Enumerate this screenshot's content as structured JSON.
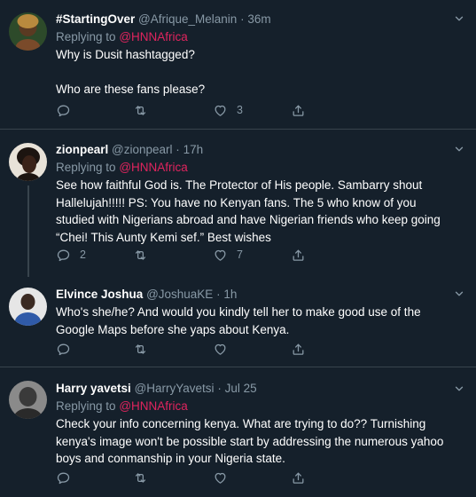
{
  "tweets": [
    {
      "name": "#StartingOver",
      "handle": "@Afrique_Melanin",
      "time": "36m",
      "reply_prefix": "Replying to",
      "reply_to": "@HNNAfrica",
      "text": "Why is Dusit hashtagged?\n\nWho are these fans please?",
      "like_count": "3",
      "avatar_colors": [
        "#b98a3e",
        "#5a3a22",
        "#2d4a2a"
      ]
    },
    {
      "name": "zionpearl",
      "handle": "@zionpearl",
      "time": "17h",
      "reply_prefix": "Replying to",
      "reply_to": "@HNNAfrica",
      "text": "See how faithful God is. The Protector of His people. Sambarry shout Hallelujah!!!!! PS: You have no Kenyan fans. The 5 who know of you studied with Nigerians abroad and have Nigerian friends who keep going “Chei! This Aunty Kemi sef.” Best wishes",
      "reply_count": "2",
      "like_count": "7",
      "avatar_colors": [
        "#e8e2d8",
        "#1c1410"
      ]
    },
    {
      "name": "Elvince Joshua",
      "handle": "@JoshuaKE",
      "time": "1h",
      "text": "Who's she/he? And would you kindly tell her to make good use of the Google Maps before she yaps about Kenya.",
      "avatar_colors": [
        "#e6e6e6",
        "#3b2a22",
        "#2f5aa8"
      ]
    },
    {
      "name": "Harry yavetsi",
      "handle": "@HarryYavetsi",
      "time": "Jul 25",
      "reply_prefix": "Replying to",
      "reply_to": "@HNNAfrica",
      "text": "Check your info concerning kenya. What are trying to do?? Turnishing kenya's image won't be possible start by addressing the numerous yahoo boys and conmanship in your Nigeria state.",
      "avatar_colors": [
        "#3a3a3a",
        "#8a8a8a"
      ]
    }
  ],
  "separator": "·",
  "colors": {
    "background": "#15202b",
    "border": "#38444d",
    "secondary_text": "#8899a6",
    "mention": "#e0245e"
  },
  "icons": [
    "reply-icon",
    "retweet-icon",
    "like-icon",
    "share-icon",
    "chevron-down-icon"
  ]
}
